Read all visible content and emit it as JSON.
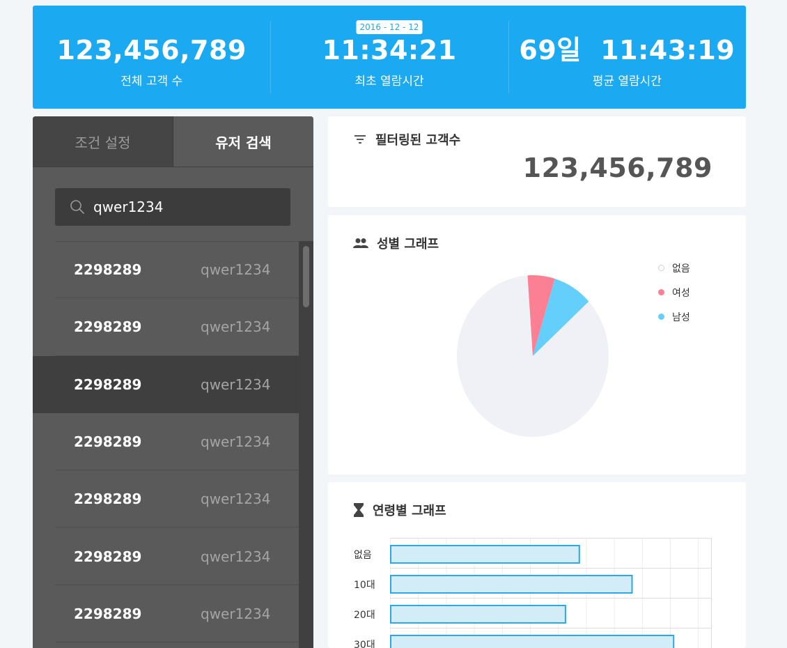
{
  "banner": {
    "stats": [
      {
        "value": "123,456,789",
        "label": "전체 고객 수"
      },
      {
        "value": "11:34:21",
        "label": "최초 열람시간",
        "badge": "2016 - 12 - 12"
      },
      {
        "value": "69일  11:43:19",
        "label": "평균 열람시간"
      }
    ]
  },
  "sidebar": {
    "tabs": [
      {
        "label": "조건 설정",
        "active": false
      },
      {
        "label": "유저 검색",
        "active": true
      }
    ],
    "search": {
      "value": "qwer1234",
      "placeholder": ""
    },
    "rows": [
      {
        "id": "2298289",
        "user": "qwer1234",
        "selected": false
      },
      {
        "id": "2298289",
        "user": "qwer1234",
        "selected": false
      },
      {
        "id": "2298289",
        "user": "qwer1234",
        "selected": true
      },
      {
        "id": "2298289",
        "user": "qwer1234",
        "selected": false
      },
      {
        "id": "2298289",
        "user": "qwer1234",
        "selected": false
      },
      {
        "id": "2298289",
        "user": "qwer1234",
        "selected": false
      },
      {
        "id": "2298289",
        "user": "qwer1234",
        "selected": false
      }
    ]
  },
  "filter_card": {
    "title": "필터링된 고객수",
    "value": "123,456,789",
    "icon": "filter-icon"
  },
  "gender_card": {
    "title": "성별 그래프",
    "icon": "people-icon",
    "legend": [
      {
        "label": "없음",
        "color": "#e8e9ee"
      },
      {
        "label": "여성",
        "color": "#fb8094"
      },
      {
        "label": "남성",
        "color": "#64cffb"
      }
    ]
  },
  "age_card": {
    "title": "연령별 그래프",
    "icon": "hourglass-icon"
  },
  "chart_data": [
    {
      "type": "pie",
      "title": "성별 그래프",
      "labels": [
        "없음",
        "여성",
        "남성"
      ],
      "values": [
        85.7,
        5.8,
        8.5
      ],
      "colors": [
        "#f0f1f6",
        "#fb8094",
        "#64cffb"
      ]
    },
    {
      "type": "bar",
      "title": "연령별 그래프",
      "orientation": "horizontal",
      "categories": [
        "없음",
        "10대",
        "20대",
        "30대"
      ],
      "values": [
        68,
        87,
        63,
        102
      ],
      "xlim": [
        0,
        116
      ],
      "grid": true,
      "bar_fill": "#d2ecf8",
      "bar_stroke": "#2aa9e6"
    }
  ]
}
